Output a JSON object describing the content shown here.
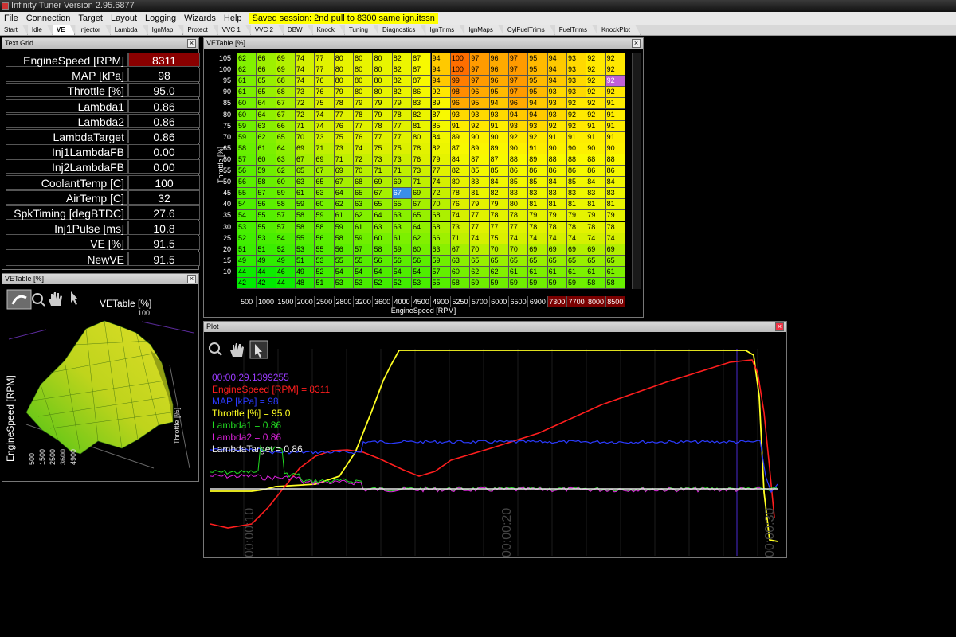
{
  "app": {
    "title": "Infinity Tuner Version 2.95.6877"
  },
  "menu": {
    "items": [
      "File",
      "Connection",
      "Target",
      "Layout",
      "Logging",
      "Wizards",
      "Help"
    ],
    "session_label": "Saved session: 2nd pull to 8300 same ign.itssn"
  },
  "tabs": [
    "Start",
    "Idle",
    "VE",
    "Injector",
    "Lambda",
    "IgnMap",
    "Protect",
    "VVC 1",
    "VVC 2",
    "DBW",
    "Knock",
    "Tuning",
    "Diagnostics",
    "IgnTrims",
    "IgnMaps",
    "CylFuelTrims",
    "FuelTrims",
    "KnockPlot"
  ],
  "active_tab": "VE",
  "text_grid": {
    "title": "Text Grid",
    "rows": [
      {
        "label": "EngineSpeed [RPM]",
        "value": "8311"
      },
      {
        "label": "MAP [kPa]",
        "value": "98"
      },
      {
        "label": "Throttle [%]",
        "value": "95.0"
      },
      {
        "label": "Lambda1",
        "value": "0.86"
      },
      {
        "label": "Lambda2",
        "value": "0.86"
      },
      {
        "label": "LambdaTarget",
        "value": "0.86"
      },
      {
        "label": "Inj1LambdaFB",
        "value": "0.00"
      },
      {
        "label": "Inj2LambdaFB",
        "value": "0.00"
      },
      {
        "label": "CoolantTemp [C]",
        "value": "100"
      },
      {
        "label": "AirTemp [C]",
        "value": "32"
      },
      {
        "label": "SpkTiming [degBTDC]",
        "value": "27.6"
      },
      {
        "label": "Inj1Pulse [ms]",
        "value": "10.8"
      },
      {
        "label": "VE [%]",
        "value": "91.5"
      },
      {
        "label": "NewVE",
        "value": "91.5"
      }
    ]
  },
  "ve_table": {
    "title": "VETable [%]",
    "y_axis_label": "Throttle [%]",
    "x_axis_label": "EngineSpeed [RPM]",
    "rpm": [
      "500",
      "1000",
      "1500",
      "2000",
      "2500",
      "2800",
      "3200",
      "3600",
      "4000",
      "4500",
      "4900",
      "5250",
      "5700",
      "6000",
      "6500",
      "6900",
      "7300",
      "7700",
      "8000",
      "8500"
    ],
    "throttle": [
      "105",
      "100",
      "95",
      "90",
      "85",
      "80",
      "75",
      "70",
      "65",
      "60",
      "55",
      "50",
      "45",
      "40",
      "35",
      "30",
      "25",
      "20",
      "15",
      "10"
    ],
    "values": [
      [
        62,
        66,
        69,
        74,
        77,
        80,
        80,
        80,
        82,
        87,
        94,
        100,
        97,
        96,
        97,
        95,
        94,
        93,
        92,
        92
      ],
      [
        62,
        66,
        69,
        74,
        77,
        80,
        80,
        80,
        82,
        87,
        94,
        100,
        97,
        96,
        97,
        95,
        94,
        93,
        92,
        92
      ],
      [
        61,
        65,
        68,
        74,
        76,
        80,
        80,
        80,
        82,
        87,
        94,
        99,
        97,
        96,
        97,
        95,
        94,
        93,
        92,
        92
      ],
      [
        61,
        65,
        68,
        73,
        76,
        79,
        80,
        80,
        82,
        86,
        92,
        98,
        96,
        95,
        97,
        95,
        93,
        93,
        92,
        92
      ],
      [
        60,
        64,
        67,
        72,
        75,
        78,
        79,
        79,
        79,
        83,
        89,
        96,
        95,
        94,
        96,
        94,
        93,
        92,
        92,
        91
      ],
      [
        60,
        64,
        67,
        72,
        74,
        77,
        78,
        79,
        78,
        82,
        87,
        93,
        93,
        93,
        94,
        94,
        93,
        92,
        92,
        91
      ],
      [
        59,
        63,
        66,
        71,
        74,
        76,
        77,
        78,
        77,
        81,
        85,
        91,
        92,
        91,
        93,
        93,
        92,
        92,
        91,
        91
      ],
      [
        59,
        62,
        65,
        70,
        73,
        75,
        76,
        77,
        77,
        80,
        84,
        89,
        90,
        90,
        92,
        92,
        91,
        91,
        91,
        91
      ],
      [
        58,
        61,
        64,
        69,
        71,
        73,
        74,
        75,
        75,
        78,
        82,
        87,
        89,
        89,
        90,
        91,
        90,
        90,
        90,
        90
      ],
      [
        57,
        60,
        63,
        67,
        69,
        71,
        72,
        73,
        73,
        76,
        79,
        84,
        87,
        87,
        88,
        89,
        88,
        88,
        88,
        88
      ],
      [
        56,
        59,
        62,
        65,
        67,
        69,
        70,
        71,
        71,
        73,
        77,
        82,
        85,
        85,
        86,
        86,
        86,
        86,
        86,
        86
      ],
      [
        56,
        58,
        60,
        63,
        65,
        67,
        68,
        69,
        69,
        71,
        74,
        80,
        83,
        84,
        85,
        85,
        84,
        85,
        84,
        84
      ],
      [
        55,
        57,
        59,
        61,
        63,
        64,
        65,
        67,
        67,
        69,
        72,
        78,
        81,
        82,
        83,
        83,
        83,
        83,
        83,
        83
      ],
      [
        54,
        56,
        58,
        59,
        60,
        62,
        63,
        65,
        65,
        67,
        70,
        76,
        79,
        79,
        80,
        81,
        81,
        81,
        81,
        81
      ],
      [
        54,
        55,
        57,
        58,
        59,
        61,
        62,
        64,
        63,
        65,
        68,
        74,
        77,
        78,
        78,
        79,
        79,
        79,
        79,
        79
      ],
      [
        53,
        55,
        57,
        58,
        58,
        59,
        61,
        63,
        63,
        64,
        68,
        73,
        77,
        77,
        77,
        78,
        78,
        78,
        78,
        78
      ],
      [
        52,
        53,
        54,
        55,
        56,
        58,
        59,
        60,
        61,
        62,
        66,
        71,
        74,
        75,
        74,
        74,
        74,
        74,
        74,
        74
      ],
      [
        51,
        51,
        52,
        53,
        55,
        56,
        57,
        58,
        59,
        60,
        63,
        67,
        70,
        70,
        70,
        69,
        69,
        69,
        69,
        69
      ],
      [
        49,
        49,
        49,
        51,
        53,
        55,
        55,
        56,
        56,
        56,
        59,
        63,
        65,
        65,
        65,
        65,
        65,
        65,
        65,
        65
      ],
      [
        44,
        44,
        46,
        49,
        52,
        54,
        54,
        54,
        54,
        54,
        57,
        60,
        62,
        62,
        61,
        61,
        61,
        61,
        61,
        61
      ],
      [
        42,
        42,
        44,
        48,
        51,
        53,
        53,
        52,
        52,
        53,
        55,
        58,
        59,
        59,
        59,
        59,
        59,
        59,
        58,
        58
      ]
    ],
    "selected_value": "67",
    "cursor_value": "92"
  },
  "ve3d": {
    "title": "VETable [%]",
    "chart_title": "VETable [%]",
    "z_max": "100",
    "y_label": "EngineSpeed [RPM]",
    "y_ticks": [
      "500",
      "1500",
      "2500",
      "3600",
      "4900"
    ],
    "x_label": "Throttle [%]"
  },
  "plot": {
    "title": "Plot",
    "timestamp": "00:00:29.1399255",
    "legend": [
      {
        "text": "EngineSpeed [RPM] = 8311",
        "color": "#ff1e1e"
      },
      {
        "text": "MAP [kPa] = 98",
        "color": "#2b3bff"
      },
      {
        "text": "Throttle [%] = 95.0",
        "color": "#ffff22"
      },
      {
        "text": "Lambda1 = 0.86",
        "color": "#22dd22"
      },
      {
        "text": "Lambda2 = 0.86",
        "color": "#dd22dd"
      },
      {
        "text": "LambdaTarget = 0.86",
        "color": "#e8e8e8"
      }
    ],
    "time_ticks": [
      "00:00:10",
      "00:00:20",
      "00:00:30"
    ]
  }
}
